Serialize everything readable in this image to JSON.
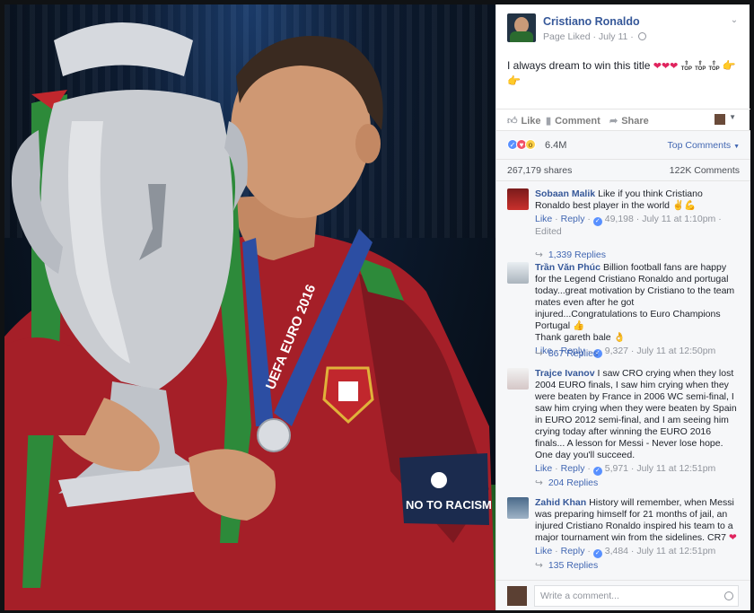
{
  "post": {
    "page_name": "Cristiano Ronaldo",
    "meta": "Page Liked · July 11 ·",
    "text": "I always dream to win this title",
    "hearts": "❤❤❤",
    "top_badge": "TOP",
    "hand_emoji": "👉",
    "actions": {
      "like": "Like",
      "comment": "Comment",
      "share": "Share"
    },
    "reaction_count": "6.4M",
    "top_comments": "Top Comments",
    "shares": "267,179 shares",
    "comments_count": "122K Comments"
  },
  "comments": [
    {
      "name": "Sobaan Malik",
      "text": "Like if you think Cristiano Ronaldo best player in the world",
      "emoji": "✌💪",
      "like": "Like",
      "reply": "Reply",
      "likes": "49,198",
      "time": "July 11 at 1:10pm",
      "edited": "Edited",
      "replies": "1,339 Replies"
    },
    {
      "name": "Trần Văn Phúc",
      "text": "Billion football fans are happy for the Legend Cristiano Ronaldo and portugal today...great motivation by Cristiano to the team mates even after he got injured...Congratulations to Euro Champions Portugal",
      "emoji": "👍",
      "text2": "Thank gareth bale",
      "emoji2": "👌",
      "like": "Like",
      "reply": "Reply",
      "likes": "9,327",
      "time": "July 11 at 12:50pm",
      "replies": "867 Replies"
    },
    {
      "name": "Trajce Ivanov",
      "text": "I saw CRO crying when they lost 2004 EURO finals, I saw him crying when they were beaten by France in 2006 WC semi-final, I saw him crying when they were beaten by Spain in EURO 2012 semi-final, and I am seeing him crying today after winning the EURO 2016 finals... A lesson for Messi - Never lose hope. One day you'll succeed.",
      "like": "Like",
      "reply": "Reply",
      "likes": "5,971",
      "time": "July 11 at 12:51pm",
      "replies": "204 Replies"
    },
    {
      "name": "Zahid Khan",
      "text": "History will remember, when Messi was preparing himself for 21 months of jail, an injured Cristiano Ronaldo inspired his team to a major tournament win from the sidelines. CR7",
      "emoji": "❤",
      "like": "Like",
      "reply": "Reply",
      "likes": "3,484",
      "time": "July 11 at 12:51pm",
      "replies": "135 Replies"
    }
  ],
  "composer": {
    "placeholder": "Write a comment..."
  },
  "photo": {
    "medal_ribbon_text": "UEFA EURO 2016",
    "armband_text": "NO TO RACISM",
    "colors": {
      "jersey": "#b3222b",
      "ribbon": "#2c4ea3",
      "trophy": "#c9ccd1",
      "green": "#2d8a3a"
    }
  }
}
